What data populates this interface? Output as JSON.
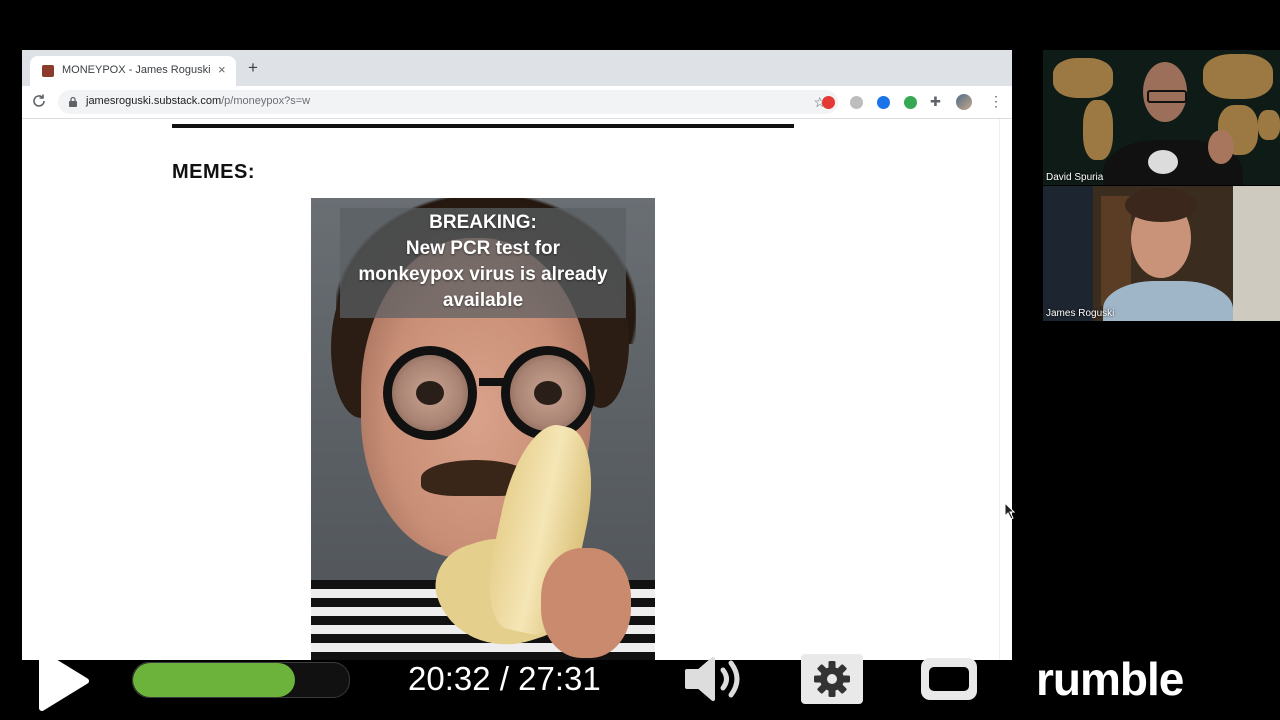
{
  "browser": {
    "tab_title": "MONEYPOX - James Roguski",
    "tab_close": "×",
    "new_tab": "+",
    "url_host": "jamesroguski.substack.com",
    "url_path": "/p/moneypox?s=w",
    "extensions": [
      "red-abp-icon",
      "gray-circle-icon",
      "blue-circle-icon",
      "green-circle-icon",
      "puzzle-icon"
    ]
  },
  "page": {
    "heading": "MEMES:",
    "meme_caption": [
      "BREAKING:",
      "New PCR test for",
      "monkeypox virus is already",
      "available"
    ]
  },
  "participants": [
    {
      "name": "David Spuria"
    },
    {
      "name": "James Roguski"
    }
  ],
  "player": {
    "current_time": "20:32",
    "separator": " / ",
    "duration": "27:31",
    "progress": 0.75,
    "logo": "rumble",
    "accent_color": "#6bb33b"
  }
}
